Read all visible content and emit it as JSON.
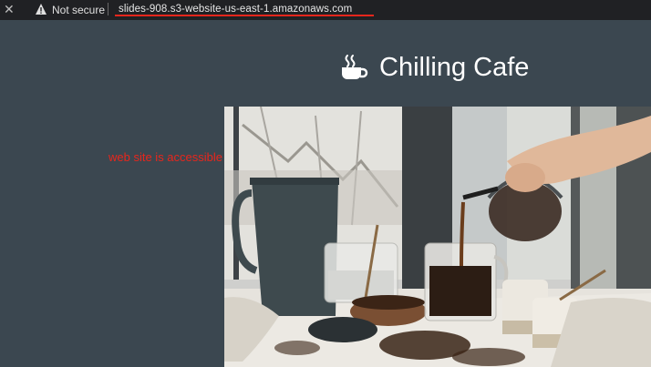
{
  "browser": {
    "security_label": "Not secure",
    "url": "slides-908.s3-website-us-east-1.amazonaws.com",
    "close_glyph": "✕"
  },
  "site": {
    "title": "Chilling Cafe",
    "logo_icon": "coffee-cup-icon"
  },
  "annotation": {
    "text": "web site is accessible",
    "color": "#e8261c"
  },
  "colors": {
    "page_background": "#3b4750",
    "address_bar": "#202124",
    "highlight": "#e8261c"
  }
}
